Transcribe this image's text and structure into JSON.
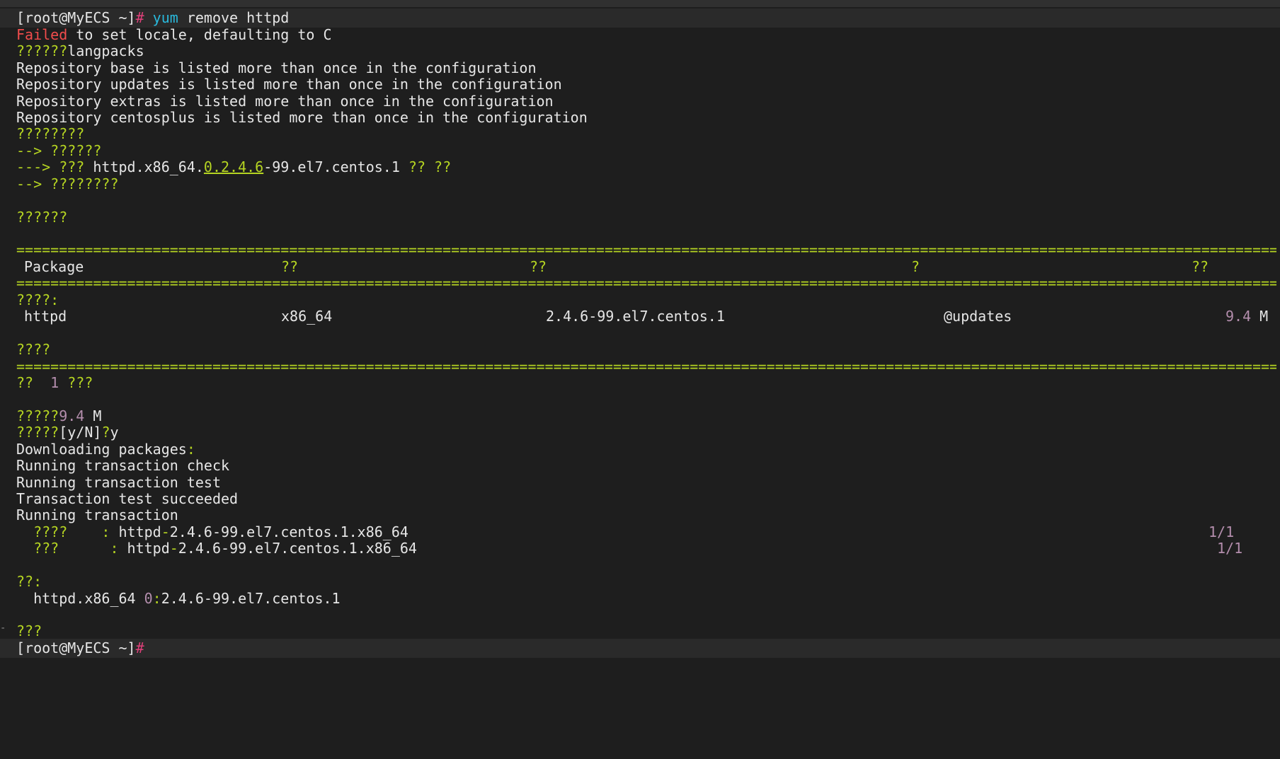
{
  "terminal": {
    "prompt": "[root@MyECS ~]",
    "prompt_symbol": "#",
    "command_name": "yum",
    "command_args": " remove httpd",
    "locale_failed_word": "Failed",
    "locale_failed_rest": " to set locale, defaulting to C",
    "langpacks_q": "??????",
    "langpacks_word": "langpacks",
    "repo_lines": [
      "Repository base is listed more than once in the configuration",
      "Repository updates is listed more than once in the configuration",
      "Repository extras is listed more than once in the configuration",
      "Repository centosplus is listed more than once in the configuration"
    ],
    "resolving": "????????",
    "arrow1": "--> ??????",
    "arrow2_prefix": "---> ??? ",
    "arrow2_pkg_a": "httpd.x86_64.",
    "arrow2_pkg_ver": "0.2.4.6",
    "arrow2_pkg_b": "-99.el7.centos.1",
    "arrow2_suffix": " ?? ??",
    "arrow3": "--> ????????",
    "deps_resolved": "??????",
    "separator": "================================================================================================================================================================",
    "table": {
      "headers": [
        "Package",
        "??",
        "??",
        "?",
        "??"
      ],
      "section": "????:",
      "row": {
        "package": "httpd",
        "arch": "x86_64",
        "version": "2.4.6-99.el7.centos.1",
        "repo": "@updates",
        "size_num": "9.4",
        "size_unit": " M"
      }
    },
    "summary_label": "????",
    "summary_q1": "??  ",
    "summary_count": "1",
    "summary_q2": " ???",
    "installed_size_label": "?????",
    "installed_size_num": "9.4",
    "installed_size_unit": " M",
    "confirm_q": "?????",
    "confirm_choice": "[y/N]",
    "confirm_q2": "?",
    "confirm_answer": "y",
    "downloading": "Downloading packages",
    "downloading_colon": ":",
    "tx_lines": [
      "Running transaction check",
      "Running transaction test",
      "Transaction test succeeded",
      "Running transaction"
    ],
    "erase": {
      "label": "  ????    ",
      "colon": ":",
      "pkg_a": " httpd",
      "pkg_b": "2.4.6",
      "pkg_c": "-99.el7.centos.1.x86_64",
      "progress": "1/1"
    },
    "verify": {
      "label": "  ???      ",
      "colon": ":",
      "pkg_a": " httpd",
      "pkg_b": "2.4.6",
      "pkg_c": "-99.el7.centos.1.x86_64",
      "progress": "1/1"
    },
    "removed_label": "??:",
    "removed_pkg": "  httpd.x86_64 ",
    "removed_epoch": "0",
    "removed_colon": ":",
    "removed_ver": "2.4.6-99.el7.centos.1",
    "complete": "???",
    "final_prompt": "[root@MyECS ~]",
    "final_symbol": "#"
  }
}
